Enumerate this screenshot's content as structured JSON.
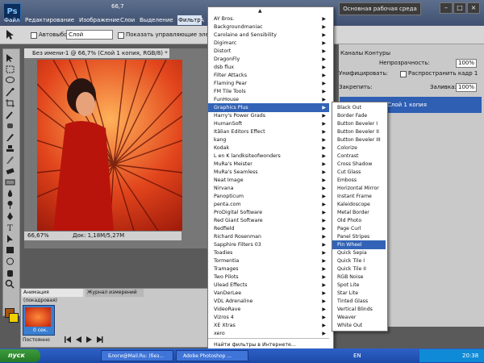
{
  "menubar": {
    "zoom": "66,7",
    "items": [
      "Файл",
      "Редактирование",
      "Изображение",
      "Слои",
      "Выделение",
      "Фильтр",
      "А"
    ],
    "workspace": "Основная рабочая среда",
    "minimize": "–",
    "maximize": "□",
    "close": "×"
  },
  "options": {
    "autoselect_label": "Автовыбор:",
    "layer_value": "Слой",
    "show_controls_label": "Показать управляющие элементы"
  },
  "document": {
    "tab_title": "Без имени-1 @ 66,7% (Слой 1 копия, RGB/8) *",
    "zoom": "66,67%",
    "doc_size": "Док: 1,18М/5,27М"
  },
  "layers_panel": {
    "tabs": [
      "Каналы",
      "Контуры"
    ],
    "opacity_label": "Непрозрачность:",
    "opacity_value": "100%",
    "unify_label": "Унифицировать:",
    "propagate_label": "Распространить кадр 1",
    "lock_label": "Закрепить:",
    "fill_label": "Заливка:",
    "fill_value": "100%",
    "layer_name": "Слой 1 копия"
  },
  "animation_panel": {
    "tab_animation": "Анимация (покадровая)",
    "tab_journal": "Журнал измерений",
    "frame_time": "0 сек.",
    "loop": "Постоянно"
  },
  "filter_menu": {
    "items": [
      {
        "label": "AY Bros.",
        "has_sub": true
      },
      {
        "label": "Backgroundmaniac",
        "has_sub": true
      },
      {
        "label": "Carolaine and Sensibility",
        "has_sub": true
      },
      {
        "label": "Digimarc",
        "has_sub": true
      },
      {
        "label": "Distort",
        "has_sub": true
      },
      {
        "label": "DragonFly",
        "has_sub": true
      },
      {
        "label": "dsb flux",
        "has_sub": true
      },
      {
        "label": "Filter Attacks",
        "has_sub": true
      },
      {
        "label": "Flaming Pear",
        "has_sub": true
      },
      {
        "label": "FM Tile Tools",
        "has_sub": true
      },
      {
        "label": "FunHouse",
        "has_sub": true
      },
      {
        "label": "Graphics Plus",
        "has_sub": true,
        "selected": true
      },
      {
        "label": "Harry's Power Grads",
        "has_sub": true
      },
      {
        "label": "HumanSoft",
        "has_sub": true
      },
      {
        "label": "Itālian Editors Effect",
        "has_sub": true
      },
      {
        "label": "kang",
        "has_sub": true
      },
      {
        "label": "Kodak",
        "has_sub": true
      },
      {
        "label": "L en K landksiteofwonders",
        "has_sub": true
      },
      {
        "label": "MuRa's Meister",
        "has_sub": true
      },
      {
        "label": "MuRa's Seamless",
        "has_sub": true
      },
      {
        "label": "Neat Image",
        "has_sub": true
      },
      {
        "label": "Nirvana",
        "has_sub": true
      },
      {
        "label": "Panopticum",
        "has_sub": true
      },
      {
        "label": "penta.com",
        "has_sub": true
      },
      {
        "label": "ProDigital Software",
        "has_sub": true
      },
      {
        "label": "Red Giant Software",
        "has_sub": true
      },
      {
        "label": "Redfield",
        "has_sub": true
      },
      {
        "label": "Richard Rosenman",
        "has_sub": true
      },
      {
        "label": "Sapphire Filters 03",
        "has_sub": true
      },
      {
        "label": "Toadies",
        "has_sub": true
      },
      {
        "label": "Tormentia",
        "has_sub": true
      },
      {
        "label": "Tramages",
        "has_sub": true
      },
      {
        "label": "Two Pilots",
        "has_sub": true
      },
      {
        "label": "Ulead Effects",
        "has_sub": true
      },
      {
        "label": "VanDerLee",
        "has_sub": true
      },
      {
        "label": "VDL Adrenaline",
        "has_sub": true
      },
      {
        "label": "VideoRave",
        "has_sub": true
      },
      {
        "label": "Vizros 4",
        "has_sub": true
      },
      {
        "label": "XE Xtras",
        "has_sub": true
      },
      {
        "label": "xero",
        "has_sub": true
      }
    ],
    "find_online": "Найти фильтры в Интернете...",
    "scroll_up": "▲",
    "scroll_down": "▼"
  },
  "submenu": {
    "items": [
      "Black Out",
      "Border Fade",
      "Button Beveler I",
      "Button Beveler II",
      "Button Beveler III",
      "Colorize",
      "Contrast",
      "Cross Shadow",
      "Cut Glass",
      "Emboss",
      "Horizontal Mirror",
      "Instant Frame",
      "Kaleidoscope",
      "Metal Border",
      "Old Photo",
      "Page Curl",
      "Panel Stripes",
      "Pin Wheel",
      "Quick Sepia",
      "Quick Tile I",
      "Quick Tile II",
      "RGB Noise",
      "Spot Lite",
      "Star Lite",
      "Tinted Glass",
      "Vertical Blinds",
      "Weaver",
      "White Out"
    ],
    "selected_index": 17
  },
  "taskbar": {
    "start": "пуск",
    "tasks": [
      "Блоги@Mail.Ru: (без...",
      "Adobe Photoshop ..."
    ],
    "lang": "EN",
    "clock": "20:38"
  },
  "colors": {
    "selection": "#3263b6",
    "taskbar": "#2e61c7"
  }
}
